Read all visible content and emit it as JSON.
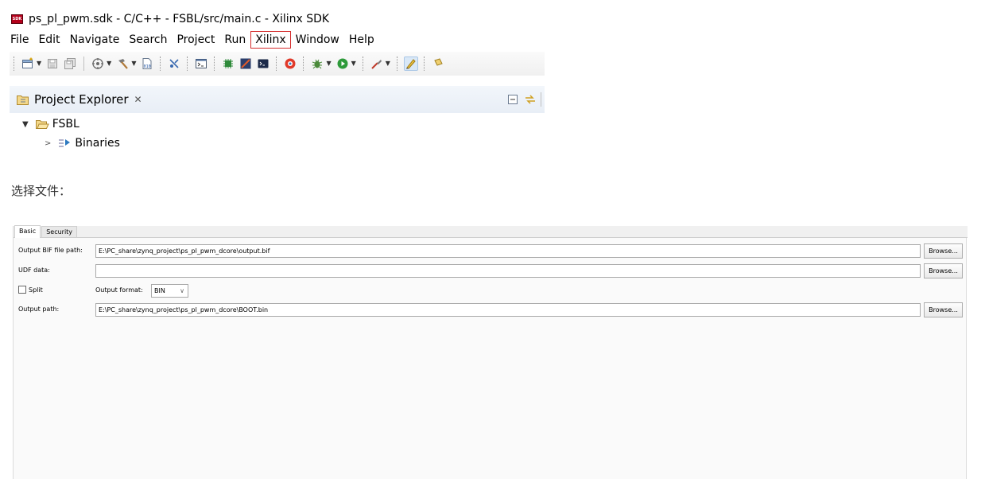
{
  "window": {
    "badge": "SDK",
    "title": "ps_pl_pwm.sdk - C/C++ - FSBL/src/main.c - Xilinx SDK"
  },
  "menu": {
    "items": [
      "File",
      "Edit",
      "Navigate",
      "Search",
      "Project",
      "Run",
      "Xilinx",
      "Window",
      "Help"
    ],
    "highlighted": "Xilinx",
    "highlight_color": "#d42b2b"
  },
  "toolbar": {
    "icons": [
      "new-icon",
      "save-icon",
      "save-all-icon",
      "build-config-icon",
      "hammer-build-icon",
      "binary-file-icon",
      "debug-stop-icon",
      "console-icon",
      "program-fpga-icon",
      "generate-bitstream-icon",
      "terminal-icon",
      "target-connection-icon",
      "debug-bug-icon",
      "run-icon",
      "external-tools-icon",
      "highlight-icon",
      "pin-icon"
    ]
  },
  "project_explorer": {
    "title": "Project Explorer",
    "close_glyph": "✕",
    "tree": [
      {
        "label": "FSBL",
        "expanded": true
      },
      {
        "label": "Binaries",
        "expanded": false
      }
    ]
  },
  "caption": "选择文件：",
  "dialog": {
    "tabs": [
      "Basic",
      "Security"
    ],
    "active_tab": "Basic",
    "rows": {
      "bif": {
        "label": "Output BIF file path:",
        "value": "E:\\PC_share\\zynq_project\\ps_pl_pwm_dcore\\output.bif",
        "button": "Browse..."
      },
      "udf": {
        "label": "UDF data:",
        "value": "",
        "button": "Browse..."
      },
      "split": {
        "label": "Split",
        "checked": false,
        "format_label": "Output format:",
        "format_value": "BIN"
      },
      "output": {
        "label": "Output path:",
        "value": "E:\\PC_share\\zynq_project\\ps_pl_pwm_dcore\\BOOT.bin",
        "button": "Browse..."
      }
    }
  }
}
